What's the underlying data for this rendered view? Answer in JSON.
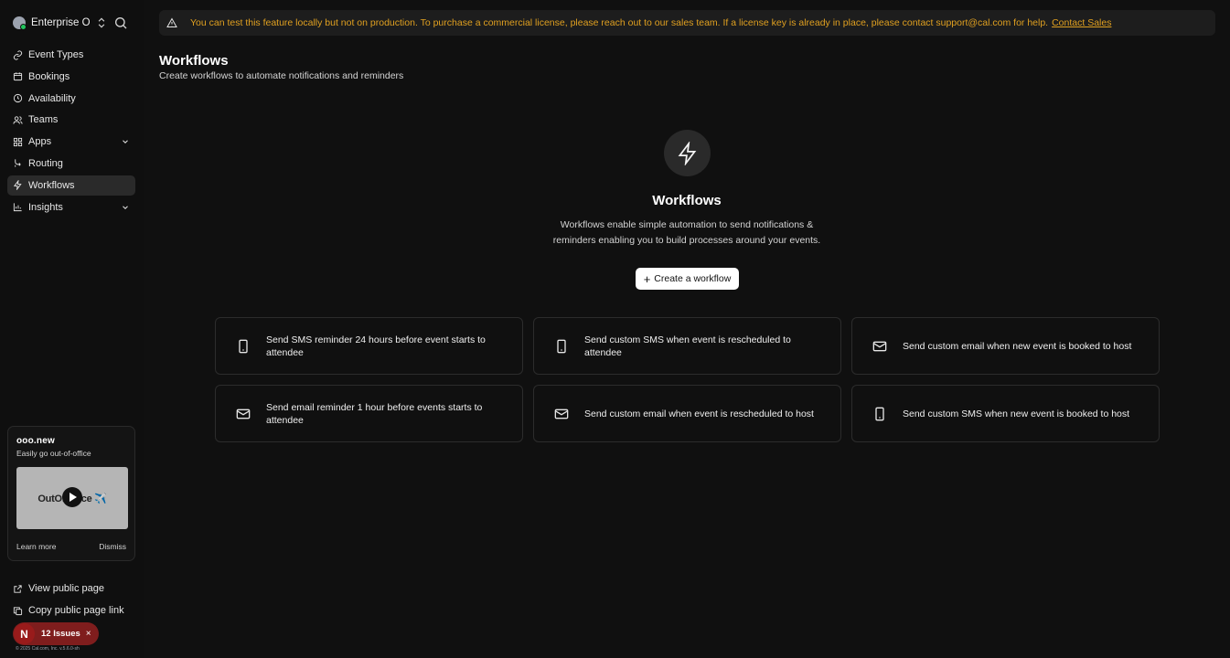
{
  "sidebar": {
    "org_name": "Enterprise Org",
    "nav": [
      {
        "label": "Event Types",
        "icon": "link-icon"
      },
      {
        "label": "Bookings",
        "icon": "calendar-icon"
      },
      {
        "label": "Availability",
        "icon": "clock-icon"
      },
      {
        "label": "Teams",
        "icon": "users-icon"
      },
      {
        "label": "Apps",
        "icon": "grid-icon"
      },
      {
        "label": "Routing",
        "icon": "split-icon"
      },
      {
        "label": "Workflows",
        "icon": "zap-icon"
      },
      {
        "label": "Insights",
        "icon": "bar-chart-icon"
      }
    ],
    "promo": {
      "logo": "ooo.new",
      "subtitle": "Easily go out-of-office",
      "thumb_text": "OutOfOffice ✈️",
      "learn_more": "Learn more",
      "dismiss": "Dismiss"
    },
    "bottom": {
      "view_public": "View public page",
      "copy_link": "Copy public page link"
    },
    "issues": {
      "badge": "N",
      "label": "12 Issues",
      "close": "×"
    },
    "copyright": "© 2025 Cal.com, Inc. v.5.6.0-sh"
  },
  "banner": {
    "text": "You can test this feature locally but not on production. To purchase a commercial license, please reach out to our sales team. If a license key is already in place, please contact support@cal.com for help.",
    "link": "Contact Sales"
  },
  "header": {
    "title": "Workflows",
    "subtitle": "Create workflows to automate notifications and reminders"
  },
  "empty": {
    "title": "Workflows",
    "description": "Workflows enable simple automation to send notifications & reminders enabling you to build processes around your events.",
    "button": "Create a workflow"
  },
  "templates": [
    {
      "label": "Send SMS reminder 24 hours before event starts to attendee",
      "icon": "phone-icon"
    },
    {
      "label": "Send custom SMS when event is rescheduled to attendee",
      "icon": "phone-icon"
    },
    {
      "label": "Send custom email when new event is booked to host",
      "icon": "mail-icon"
    },
    {
      "label": "Send email reminder 1 hour before events starts to attendee",
      "icon": "mail-icon"
    },
    {
      "label": "Send custom email when event is rescheduled to host",
      "icon": "mail-icon"
    },
    {
      "label": "Send custom SMS when new event is booked to host",
      "icon": "phone-icon"
    }
  ]
}
